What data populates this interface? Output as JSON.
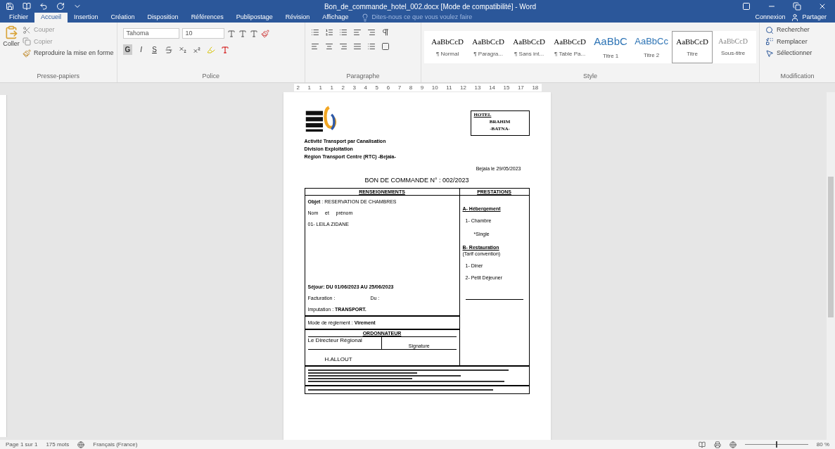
{
  "window": {
    "title": "Bon_de_commande_hotel_002.docx [Mode de compatibilité] - Word"
  },
  "tabs": [
    {
      "label": "Fichier",
      "selected": false
    },
    {
      "label": "Accueil",
      "selected": true
    },
    {
      "label": "Insertion",
      "selected": false
    },
    {
      "label": "Création",
      "selected": false
    },
    {
      "label": "Disposition",
      "selected": false
    },
    {
      "label": "Références",
      "selected": false
    },
    {
      "label": "Publipostage",
      "selected": false
    },
    {
      "label": "Révision",
      "selected": false
    },
    {
      "label": "Affichage",
      "selected": false
    }
  ],
  "tell_me": {
    "placeholder": "Dites-nous ce que vous voulez faire"
  },
  "account": {
    "sign_in": "Connexion",
    "share": "Partager"
  },
  "clipboard": {
    "paste": "Coller",
    "cut": "Couper",
    "copy": "Copier",
    "format_painter": "Reproduire la mise en forme",
    "label": "Presse-papiers"
  },
  "font": {
    "name": "Tahoma",
    "size": "10",
    "format_letters": [
      "G",
      "I",
      "S"
    ],
    "label": "Police"
  },
  "paragraph": {
    "label": "Paragraphe"
  },
  "styles": {
    "label": "Style",
    "items": [
      {
        "preview": "AaBbCcD",
        "name": "¶ Normal",
        "kind": "body",
        "selected": false
      },
      {
        "preview": "AaBbCcD",
        "name": "¶ Paragra...",
        "kind": "body",
        "selected": false
      },
      {
        "preview": "AaBbCcD",
        "name": "¶ Sans int...",
        "kind": "body",
        "selected": false
      },
      {
        "preview": "AaBbCcD",
        "name": "¶ Table Pa...",
        "kind": "body",
        "selected": false
      },
      {
        "preview": "AaBbC",
        "name": "Titre 1",
        "kind": "heading",
        "selected": false
      },
      {
        "preview": "AaBbCc",
        "name": "Titre 2",
        "kind": "heading2",
        "selected": false
      },
      {
        "preview": "AaBbCcD",
        "name": "Titre",
        "kind": "body",
        "selected": true
      },
      {
        "preview": "AaBbCcD",
        "name": "Sous-titre",
        "kind": "subtle",
        "selected": false
      }
    ]
  },
  "editing": {
    "label": "Modification",
    "items": [
      "Rechercher",
      "Remplacer",
      "Sélectionner"
    ]
  },
  "ruler": {
    "marks": [
      "2",
      "1",
      "1",
      "1",
      "2",
      "3",
      "4",
      "5",
      "6",
      "7",
      "8",
      "9",
      "10",
      "11",
      "12",
      "13",
      "14",
      "15",
      "17",
      "18"
    ]
  },
  "document": {
    "org_lines": [
      "Activité Transport par Canalisation",
      "Division Exploitation",
      "Région Transport Centre (RTC) -Bejaia-"
    ],
    "hotel_box": [
      "HOTEL",
      "BRAHIM",
      "-BATNA-"
    ],
    "date": "Bejaia le 29/05/2023",
    "title": "BON DE COMMANDE N° : 002/2023",
    "left_header": "RENSEIGNEMENTS",
    "right_header": "PRESTATIONS",
    "object": "**Objet** : RESERVATION DE CHAMBRES",
    "name_label": "Nom     et     prénom",
    "name": "01- LEILA ZIDANE",
    "stay": "Séjour: DU 01/06/2023 AU 25/06/2023",
    "billing": "Facturation :",
    "billing_from": "Du :",
    "imputation": "Imputation : **TRANSPORT.**",
    "payment": "Mode de règlement : **Virement**",
    "orderer_header": "ORDONNATEUR",
    "orderer_role": "Le Directeur Régional",
    "signature": "Signature",
    "orderer_name": "H.ALLOUT",
    "services": [
      {
        "text": "A- Hébergement",
        "kind": "heading"
      },
      {
        "text": "1- Chambre",
        "kind": "item"
      },
      {
        "text": "*Single",
        "kind": "sub"
      },
      {
        "text": "B- Restauration",
        "kind": "heading"
      },
      {
        "text": "(Tarif convention)",
        "kind": "note"
      },
      {
        "text": "1- Diner",
        "kind": "item"
      },
      {
        "text": "2- Petit Déjeuner",
        "kind": "item"
      }
    ]
  },
  "status_bar": {
    "page": "Page 1 sur 1",
    "words": "175 mots",
    "language": "Français (France)",
    "zoom": "80 %",
    "zoom_slider": {
      "level": 0.5
    }
  }
}
